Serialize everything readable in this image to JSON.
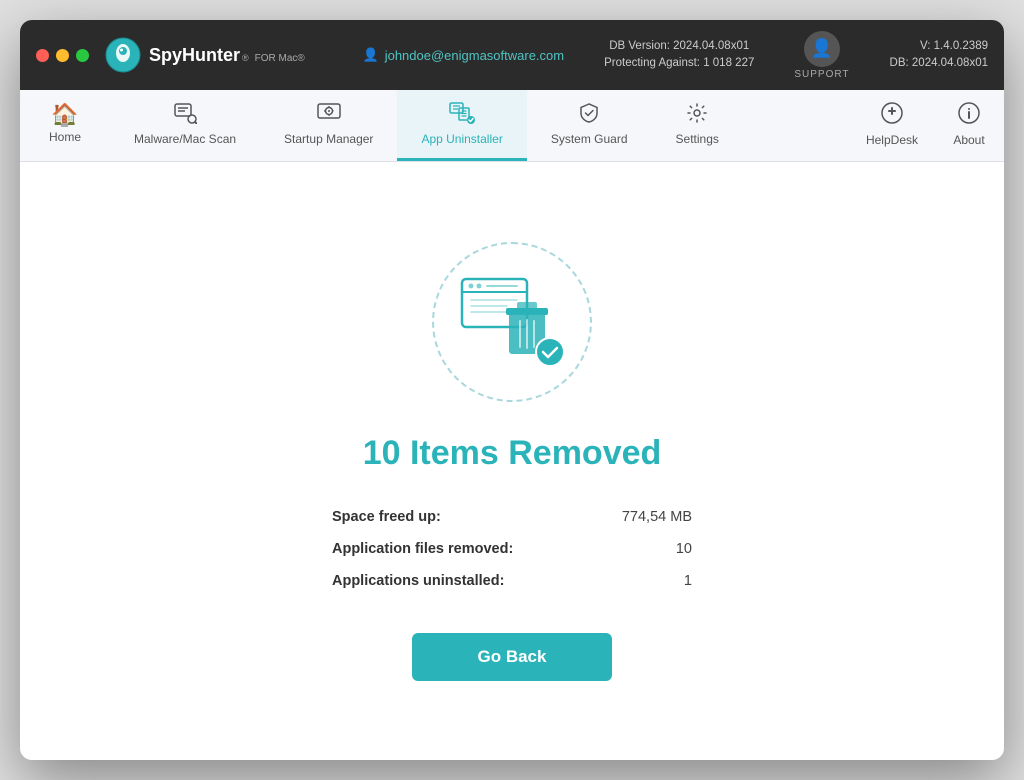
{
  "window": {
    "title": "SpyHunter for Mac"
  },
  "titlebar": {
    "logo_name": "SpyHunter",
    "logo_sup": "®",
    "logo_for_mac": "FOR Mac®",
    "user_email": "johndoe@enigmasoftware.com",
    "db_version_label": "DB Version: 2024.04.08x01",
    "protecting_label": "Protecting Against: 1 018 227",
    "support_label": "SUPPORT",
    "version": "V: 1.4.0.2389",
    "db_date": "DB:  2024.04.08x01"
  },
  "nav": {
    "items": [
      {
        "id": "home",
        "label": "Home",
        "icon": "🏠"
      },
      {
        "id": "malware-scan",
        "label": "Malware/Mac Scan",
        "icon": "🔍"
      },
      {
        "id": "startup-manager",
        "label": "Startup Manager",
        "icon": "⚙"
      },
      {
        "id": "app-uninstaller",
        "label": "App Uninstaller",
        "icon": "🗑",
        "active": true
      },
      {
        "id": "system-guard",
        "label": "System Guard",
        "icon": "🛡"
      },
      {
        "id": "settings",
        "label": "Settings",
        "icon": "⚙"
      },
      {
        "id": "helpdesk",
        "label": "HelpDesk",
        "icon": "➕"
      },
      {
        "id": "about",
        "label": "About",
        "icon": "ℹ"
      }
    ]
  },
  "main": {
    "result_title": "10 Items Removed",
    "stats": [
      {
        "label": "Space freed up:",
        "value": "774,54 MB"
      },
      {
        "label": "Application files removed:",
        "value": "10"
      },
      {
        "label": "Applications uninstalled:",
        "value": "1"
      }
    ],
    "go_back_label": "Go Back"
  }
}
